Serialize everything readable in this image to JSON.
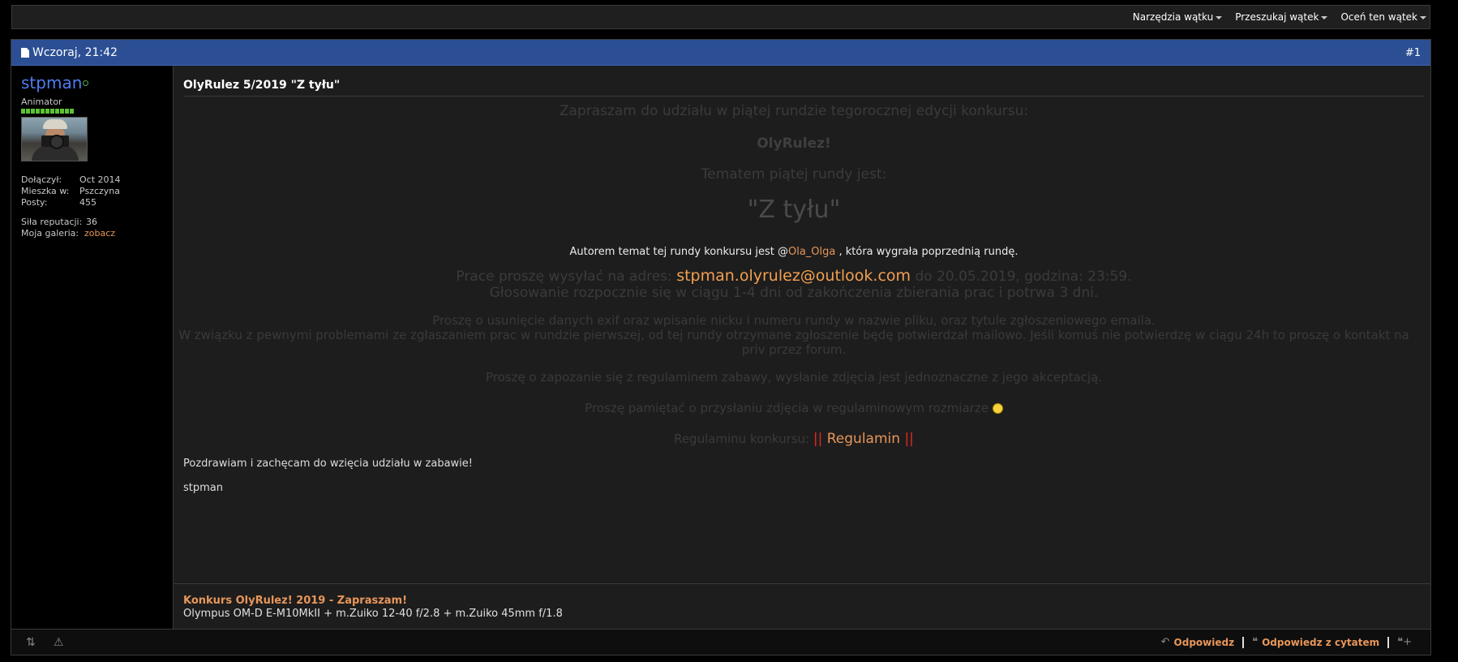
{
  "toolbar": {
    "items": [
      "Narzędzia wątku",
      "Przeszukaj wątek",
      "Oceń ten wątek"
    ]
  },
  "post": {
    "date": "Wczoraj, 21:42",
    "number": "#1",
    "user": {
      "name": "stpman",
      "title": "Animator",
      "joined_label": "Dołączył:",
      "joined_value": "Oct 2014",
      "location_label": "Mieszka w:",
      "location_value": "Pszczyna",
      "posts_label": "Posty:",
      "posts_value": "455",
      "rep_label": "Siła reputacji:",
      "rep_value": "36",
      "gallery_label": "Moja galeria:",
      "gallery_value": "zobacz"
    },
    "title": "OlyRulez 5/2019 \"Z tyłu\"",
    "body": {
      "invite": "Zapraszam do udziału w piątej rundzie tegorocznej edycji konkursu:",
      "contest": "OlyRulez!",
      "theme_intro": "Tematem piątej rundy jest:",
      "theme": "\"Z tyłu\"",
      "author_pre": "Autorem temat tej rundy konkursu jest @",
      "author_name": "Ola_Olga",
      "author_post": " , która wygrała poprzednią rundę.",
      "send_pre": "Prace proszę wysyłać na adres: ",
      "email": "stpman.olyrulez@outlook.com",
      "send_post": " do 20.05.2019, godzina: 23:59.",
      "voting": "Głosowanie rozpocznie się w ciągu 1-4 dni od zakończenia zbierania prac i potrwa 3 dni.",
      "exif": "Proszę o usunięcie danych exif oraz wpisanie nicku i numeru rundy w nazwie pliku, oraz tytule zgłoszeniowego emaila.",
      "problems_1": "W związku z pewnymi problemami ze zgłaszaniem prac w rundzie pierwszej, od tej rundy otrzymane zgłoszenie będę potwierdzał mailowo. Jeśli komuś nie potwierdzę w ciągu 24h to proszę o kontakt na",
      "problems_2": "priv przez forum.",
      "rules": "Proszę o zapozanie się z regulaminem zabawy, wysłanie zdjęcia jest jednoznaczne z jego akceptacją.",
      "size": "Proszę pamiętać o przysłaniu zdjęcia w regulaminowym rozmiarze",
      "regl_pre": "Regulaminu konkursu: ",
      "regl_bars_l": "||",
      "regl_link": " Regulamin ",
      "regl_bars_r": "||",
      "greeting": "Pozdrawiam i zachęcam do wzięcia udziału w zabawie!",
      "sign": "stpman"
    },
    "signature": {
      "link": "Konkurs OlyRulez! 2019 - Zapraszam!",
      "gear": "Olympus OM-D E-M10MkII + m.Zuiko 12-40 f/2.8 + m.Zuiko 45mm f/1.8"
    },
    "footer": {
      "reply": "Odpowiedz",
      "quote_reply": "Odpowiedz z cytatem"
    }
  }
}
